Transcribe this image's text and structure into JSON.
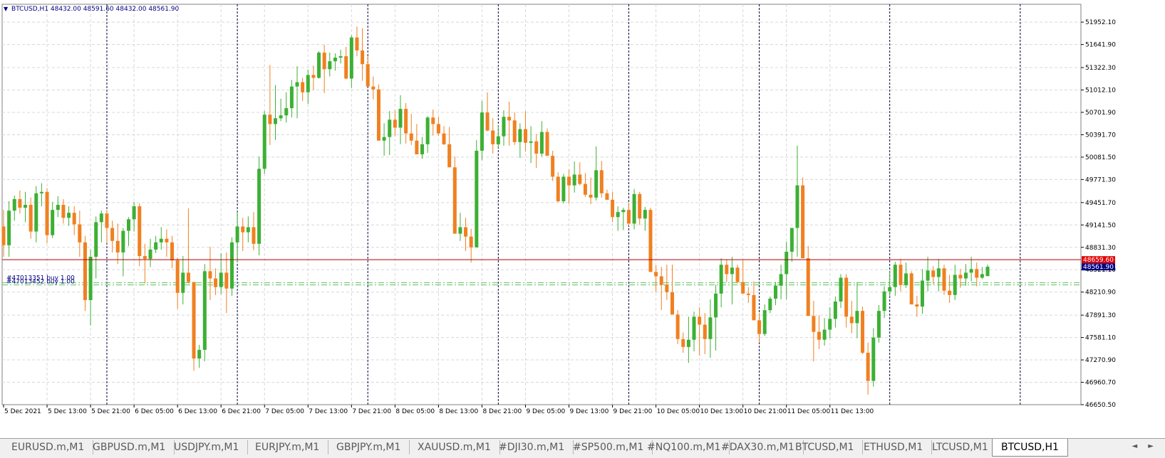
{
  "symbol_title": "BTCUSD,H1  48432.00 48591.60 48432.00 48561.90",
  "symbol_title_arrow": "▼",
  "chart_data": {
    "type": "candlestick",
    "symbol": "BTCUSD",
    "timeframe": "H1",
    "ylim": [
      46650.5,
      52200
    ],
    "y_ticks": [
      "51952.10",
      "51641.90",
      "51322.30",
      "51012.10",
      "50701.90",
      "50391.70",
      "50081.50",
      "49771.30",
      "49451.70",
      "49141.50",
      "48831.30",
      "48521.10",
      "48210.90",
      "47891.30",
      "47581.10",
      "47270.90",
      "46960.70",
      "46650.50"
    ],
    "x_ticks": [
      "5 Dec 2021",
      "5 Dec 13:00",
      "5 Dec 21:00",
      "6 Dec 05:00",
      "6 Dec 13:00",
      "6 Dec 21:00",
      "7 Dec 05:00",
      "7 Dec 13:00",
      "7 Dec 21:00",
      "8 Dec 05:00",
      "8 Dec 13:00",
      "8 Dec 21:00",
      "9 Dec 05:00",
      "9 Dec 13:00",
      "9 Dec 21:00",
      "10 Dec 05:00",
      "10 Dec 13:00",
      "10 Dec 21:00",
      "11 Dec 05:00",
      "11 Dec 13:00"
    ],
    "price_lines": {
      "ask": {
        "value": 48659.6,
        "label": "48659.60",
        "color": "#e00000"
      },
      "bid": {
        "value": 48561.9,
        "label": "48561.90",
        "color": "#000080"
      }
    },
    "order_lines": [
      {
        "label": "#47013351 buy 1.00",
        "value": 48340
      },
      {
        "label": "#47013452 buy 1.00",
        "value": 48310
      }
    ],
    "up_color": "#3cb034",
    "down_color": "#f08020",
    "candles": [
      [
        49120,
        49350,
        48700,
        48860
      ],
      [
        48860,
        49470,
        48700,
        49340
      ],
      [
        49340,
        49550,
        49200,
        49500
      ],
      [
        49500,
        49620,
        49300,
        49380
      ],
      [
        49380,
        49600,
        49180,
        49420
      ],
      [
        49420,
        49520,
        48950,
        49050
      ],
      [
        49050,
        49680,
        48900,
        49580
      ],
      [
        49580,
        49720,
        49400,
        49600
      ],
      [
        49600,
        49650,
        48890,
        49000
      ],
      [
        49000,
        49460,
        48960,
        49350
      ],
      [
        49350,
        49540,
        49250,
        49420
      ],
      [
        49420,
        49500,
        49160,
        49240
      ],
      [
        49240,
        49400,
        49130,
        49310
      ],
      [
        49310,
        49400,
        49000,
        49150
      ],
      [
        49150,
        49340,
        48700,
        48900
      ],
      [
        48900,
        48990,
        47950,
        48100
      ],
      [
        48100,
        48800,
        47750,
        48700
      ],
      [
        48700,
        49260,
        48400,
        49180
      ],
      [
        49180,
        49340,
        48900,
        49300
      ],
      [
        49300,
        49350,
        48890,
        49100
      ],
      [
        49100,
        49200,
        48760,
        48920
      ],
      [
        48920,
        49160,
        48600,
        48760
      ],
      [
        48760,
        49100,
        48430,
        49060
      ],
      [
        49060,
        49250,
        48850,
        49220
      ],
      [
        49220,
        49460,
        49050,
        49400
      ],
      [
        49400,
        49440,
        48570,
        48710
      ],
      [
        48710,
        48880,
        48330,
        48670
      ],
      [
        48670,
        48950,
        48560,
        48800
      ],
      [
        48800,
        48990,
        48750,
        48900
      ],
      [
        48900,
        49110,
        48800,
        48950
      ],
      [
        48950,
        49080,
        48700,
        48900
      ],
      [
        48900,
        48990,
        48540,
        48650
      ],
      [
        48650,
        48690,
        47980,
        48200
      ],
      [
        48200,
        48710,
        48040,
        48480
      ],
      [
        48480,
        49370,
        48330,
        48350
      ],
      [
        48350,
        48350,
        47120,
        47290
      ],
      [
        47290,
        47480,
        47160,
        47410
      ],
      [
        47410,
        48600,
        47250,
        48500
      ],
      [
        48500,
        48840,
        48100,
        48400
      ],
      [
        48400,
        48540,
        48170,
        48280
      ],
      [
        48280,
        48750,
        48180,
        48480
      ],
      [
        48480,
        48760,
        47920,
        48260
      ],
      [
        48260,
        48970,
        48160,
        48900
      ],
      [
        48900,
        49320,
        48620,
        49120
      ],
      [
        49120,
        49240,
        48780,
        49040
      ],
      [
        49040,
        49260,
        48900,
        49110
      ],
      [
        49110,
        49320,
        48790,
        48880
      ],
      [
        48880,
        50090,
        48720,
        49920
      ],
      [
        49920,
        50720,
        49850,
        50670
      ],
      [
        50670,
        51360,
        50250,
        50540
      ],
      [
        50540,
        51080,
        50320,
        50620
      ],
      [
        50620,
        50890,
        50580,
        50660
      ],
      [
        50660,
        50980,
        50560,
        50760
      ],
      [
        50760,
        51150,
        50630,
        51060
      ],
      [
        51060,
        51340,
        50620,
        51120
      ],
      [
        51120,
        51180,
        50860,
        50980
      ],
      [
        50980,
        51290,
        50820,
        51220
      ],
      [
        51220,
        51350,
        51010,
        51180
      ],
      [
        51180,
        51550,
        51170,
        51530
      ],
      [
        51530,
        51640,
        50970,
        51300
      ],
      [
        51300,
        51530,
        51200,
        51410
      ],
      [
        51410,
        51520,
        51280,
        51460
      ],
      [
        51460,
        51570,
        51380,
        51480
      ],
      [
        51480,
        51610,
        51160,
        51170
      ],
      [
        51170,
        51770,
        51040,
        51740
      ],
      [
        51740,
        51890,
        51480,
        51560
      ],
      [
        51560,
        51870,
        51140,
        51370
      ],
      [
        51370,
        51480,
        51120,
        51060
      ],
      [
        51060,
        51200,
        50880,
        51020
      ],
      [
        51020,
        51090,
        50420,
        50310
      ],
      [
        50310,
        50550,
        50100,
        50360
      ],
      [
        50360,
        50720,
        50110,
        50600
      ],
      [
        50600,
        50730,
        50370,
        50490
      ],
      [
        50490,
        50940,
        50260,
        50750
      ],
      [
        50750,
        50830,
        50270,
        50410
      ],
      [
        50410,
        50680,
        50250,
        50310
      ],
      [
        50310,
        50540,
        50160,
        50120
      ],
      [
        50120,
        50360,
        50060,
        50260
      ],
      [
        50260,
        50650,
        50140,
        50630
      ],
      [
        50630,
        50740,
        50380,
        50540
      ],
      [
        50540,
        50640,
        50380,
        50410
      ],
      [
        50410,
        50510,
        50250,
        50260
      ],
      [
        50260,
        50500,
        49960,
        49940
      ],
      [
        49940,
        50090,
        49040,
        49020
      ],
      [
        49020,
        49310,
        48920,
        49110
      ],
      [
        49110,
        49240,
        48780,
        48980
      ],
      [
        48980,
        49090,
        48620,
        48830
      ],
      [
        48830,
        50320,
        48880,
        50170
      ],
      [
        50170,
        50860,
        50040,
        50700
      ],
      [
        50700,
        50980,
        50440,
        50450
      ],
      [
        50450,
        50620,
        50130,
        50260
      ],
      [
        50260,
        50520,
        50210,
        50370
      ],
      [
        50370,
        50730,
        50240,
        50640
      ],
      [
        50640,
        50850,
        50240,
        50590
      ],
      [
        50590,
        50700,
        50250,
        50290
      ],
      [
        50290,
        50550,
        50070,
        50470
      ],
      [
        50470,
        50720,
        50160,
        50280
      ],
      [
        50280,
        50510,
        50000,
        50300
      ],
      [
        50300,
        50400,
        49930,
        50130
      ],
      [
        50130,
        50580,
        50090,
        50430
      ],
      [
        50430,
        50480,
        50160,
        50100
      ],
      [
        50100,
        50170,
        49750,
        49810
      ],
      [
        49810,
        49870,
        49450,
        49470
      ],
      [
        49470,
        49850,
        49440,
        49810
      ],
      [
        49810,
        49910,
        49440,
        49690
      ],
      [
        49690,
        50020,
        49590,
        49840
      ],
      [
        49840,
        50010,
        49690,
        49710
      ],
      [
        49710,
        49860,
        49530,
        49560
      ],
      [
        49560,
        49800,
        49430,
        49520
      ],
      [
        49520,
        50230,
        49480,
        49900
      ],
      [
        49900,
        50030,
        49520,
        49580
      ],
      [
        49580,
        49630,
        49500,
        49490
      ],
      [
        49490,
        49600,
        49180,
        49250
      ],
      [
        49250,
        49400,
        49060,
        49320
      ],
      [
        49320,
        49380,
        49070,
        49350
      ],
      [
        49350,
        49450,
        49130,
        49160
      ],
      [
        49160,
        49640,
        49080,
        49570
      ],
      [
        49570,
        49600,
        49140,
        49230
      ],
      [
        49230,
        49390,
        49060,
        49350
      ],
      [
        49350,
        49380,
        48960,
        48490
      ],
      [
        48490,
        48580,
        48210,
        48430
      ],
      [
        48430,
        48560,
        47960,
        48310
      ],
      [
        48310,
        48590,
        48100,
        48210
      ],
      [
        48210,
        48590,
        48130,
        47900
      ],
      [
        47900,
        47960,
        47490,
        47560
      ],
      [
        47560,
        47650,
        47370,
        47450
      ],
      [
        47450,
        47870,
        47230,
        47550
      ],
      [
        47550,
        47940,
        47390,
        47870
      ],
      [
        47870,
        48000,
        47330,
        47760
      ],
      [
        47760,
        47920,
        47350,
        47560
      ],
      [
        47560,
        48110,
        47300,
        47860
      ],
      [
        47860,
        48310,
        47400,
        48190
      ],
      [
        48190,
        48680,
        48000,
        48590
      ],
      [
        48590,
        48660,
        48350,
        48460
      ],
      [
        48460,
        48700,
        48040,
        48550
      ],
      [
        48550,
        48590,
        48330,
        48350
      ],
      [
        48350,
        48650,
        48230,
        48190
      ],
      [
        48190,
        48280,
        48060,
        48170
      ],
      [
        48170,
        48360,
        47990,
        47820
      ],
      [
        47820,
        47920,
        47510,
        47630
      ],
      [
        47630,
        48040,
        47600,
        47960
      ],
      [
        47960,
        48150,
        47920,
        48120
      ],
      [
        48120,
        48350,
        48030,
        48300
      ],
      [
        48300,
        48590,
        48110,
        48460
      ],
      [
        48460,
        48910,
        48110,
        48770
      ],
      [
        48770,
        49070,
        48630,
        49100
      ],
      [
        49100,
        50240,
        48700,
        49690
      ],
      [
        49690,
        49800,
        48850,
        48680
      ],
      [
        48680,
        48850,
        48030,
        47880
      ],
      [
        47880,
        48090,
        47250,
        47660
      ],
      [
        47660,
        47890,
        47420,
        47550
      ],
      [
        47550,
        47850,
        47470,
        47690
      ],
      [
        47690,
        48000,
        47570,
        47840
      ],
      [
        47840,
        48150,
        47720,
        48080
      ],
      [
        48080,
        48460,
        47990,
        48410
      ],
      [
        48410,
        48460,
        47720,
        47870
      ],
      [
        47870,
        48090,
        47640,
        47780
      ],
      [
        47780,
        48350,
        47570,
        47950
      ],
      [
        47950,
        48010,
        47350,
        47370
      ],
      [
        47370,
        47510,
        46790,
        46980
      ],
      [
        46980,
        47710,
        46900,
        47580
      ],
      [
        47580,
        48030,
        47510,
        47950
      ],
      [
        47950,
        48290,
        47850,
        48220
      ],
      [
        48220,
        48510,
        48150,
        48280
      ],
      [
        48280,
        48630,
        48160,
        48590
      ],
      [
        48590,
        48670,
        48220,
        48310
      ],
      [
        48310,
        48620,
        48270,
        48470
      ],
      [
        48470,
        48500,
        48070,
        48040
      ],
      [
        48040,
        48160,
        47870,
        48010
      ],
      [
        48010,
        48530,
        47910,
        48370
      ],
      [
        48370,
        48700,
        48220,
        48510
      ],
      [
        48510,
        48570,
        48320,
        48420
      ],
      [
        48420,
        48670,
        48220,
        48540
      ],
      [
        48540,
        48590,
        48170,
        48230
      ],
      [
        48230,
        48450,
        48060,
        48170
      ],
      [
        48170,
        48590,
        48100,
        48450
      ],
      [
        48450,
        48530,
        48270,
        48400
      ],
      [
        48400,
        48600,
        48300,
        48480
      ],
      [
        48480,
        48700,
        48360,
        48530
      ],
      [
        48530,
        48620,
        48290,
        48410
      ],
      [
        48410,
        48560,
        48390,
        48460
      ],
      [
        48432,
        48592,
        48432,
        48562
      ]
    ]
  },
  "tabs": [
    "EURUSD.m,M1",
    "GBPUSD.m,M1",
    "USDJPY.m,M1",
    "EURJPY.m,M1",
    "GBPJPY.m,M1",
    "XAUUSD.m,M1",
    "#DJI30.m,M1",
    "#SP500.m,M1",
    "#NQ100.m,M1",
    "#DAX30.m,M1",
    "BTCUSD,M1",
    "ETHUSD,M1",
    "LTCUSD,M1",
    "BTCUSD,H1"
  ],
  "active_tab": "BTCUSD,H1",
  "tab_nav": "◄ ►"
}
